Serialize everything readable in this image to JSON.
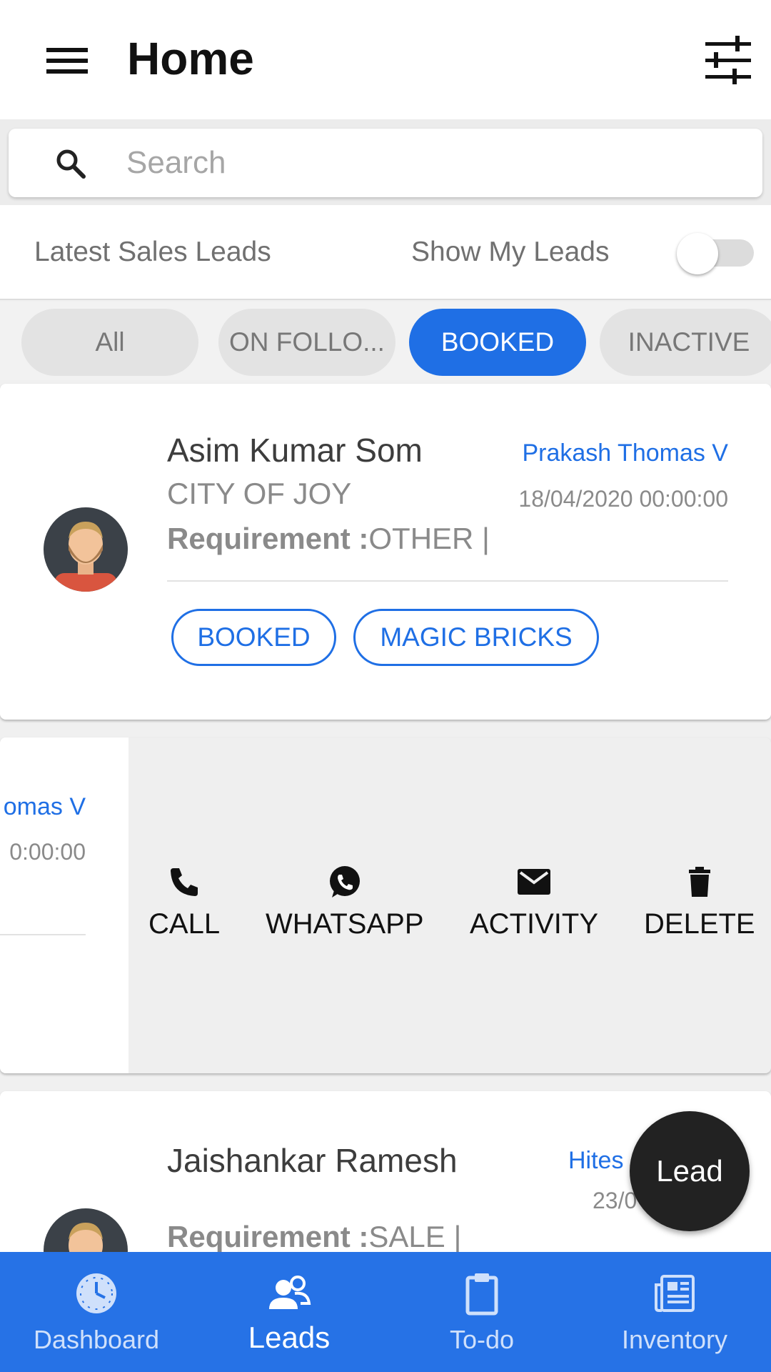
{
  "header": {
    "title": "Home",
    "menu_icon": "hamburger-menu-icon",
    "filter_icon": "sliders-filter-icon"
  },
  "search": {
    "placeholder": "Search",
    "icon": "search-icon"
  },
  "leads_bar": {
    "heading": "Latest Sales Leads",
    "toggle_label": "Show My Leads",
    "toggle_on": false
  },
  "filters": {
    "chips": [
      {
        "label": "All",
        "active": false
      },
      {
        "label": "ON FOLLO...",
        "active": false
      },
      {
        "label": "BOOKED",
        "active": true
      },
      {
        "label": "INACTIVE",
        "active": false
      }
    ]
  },
  "leads": [
    {
      "name": "Asim Kumar Som",
      "city": "CITY OF JOY",
      "requirement_label": "Requirement :",
      "requirement_value": "OTHER |",
      "assignee": "Prakash Thomas V",
      "date": "18/04/2020 00:00:00",
      "tags": [
        "BOOKED",
        "MAGIC BRICKS"
      ]
    },
    {
      "assignee_partial": "omas V",
      "date_partial": "0:00:00"
    },
    {
      "name": "Jaishankar Ramesh",
      "requirement_label": "Requirement :",
      "requirement_value": "SALE |",
      "assignee_partial": "Hites",
      "date_partial": "23/0"
    }
  ],
  "swipe_actions": [
    {
      "label": "CALL",
      "icon": "phone-icon"
    },
    {
      "label": "WHATSAPP",
      "icon": "whatsapp-icon"
    },
    {
      "label": "ACTIVITY",
      "icon": "mail-icon"
    },
    {
      "label": "DELETE",
      "icon": "trash-icon"
    }
  ],
  "fab": {
    "label": "Lead"
  },
  "bottom_nav": {
    "items": [
      {
        "label": "Dashboard",
        "icon": "dashboard-clock-icon",
        "active": false
      },
      {
        "label": "Leads",
        "icon": "people-icon",
        "active": true
      },
      {
        "label": "To-do",
        "icon": "clipboard-icon",
        "active": false
      },
      {
        "label": "Inventory",
        "icon": "newspaper-icon",
        "active": false
      }
    ]
  },
  "colors": {
    "accent": "#1f6fe5",
    "nav_background": "#2672e6",
    "fab": "#222222"
  }
}
